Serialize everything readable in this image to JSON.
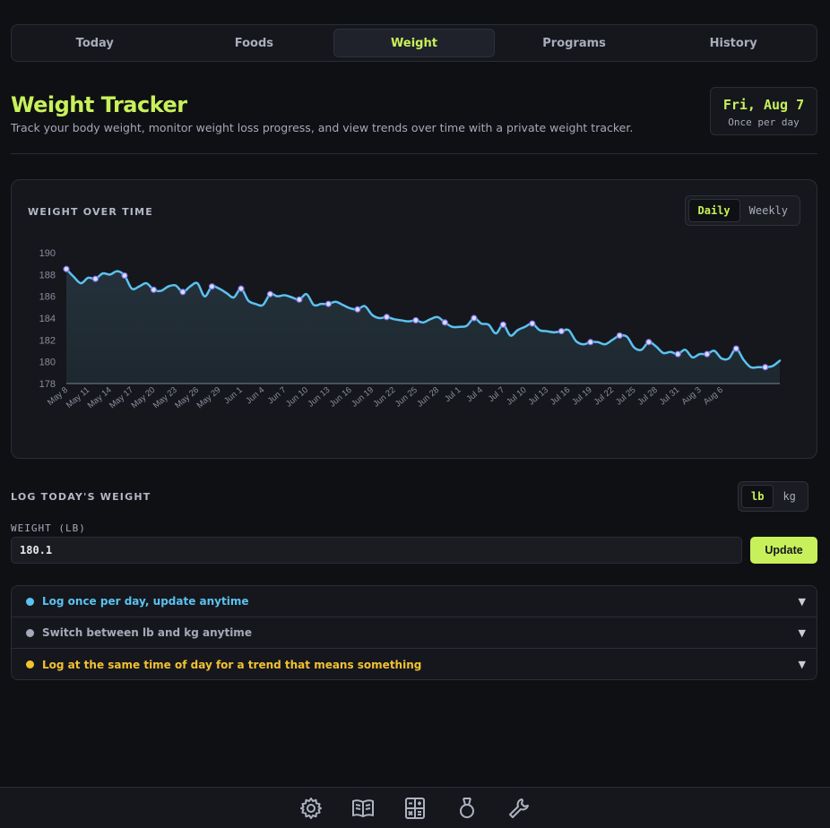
{
  "nav": {
    "tabs": [
      {
        "label": "Today"
      },
      {
        "label": "Foods"
      },
      {
        "label": "Weight"
      },
      {
        "label": "Programs"
      },
      {
        "label": "History"
      }
    ],
    "active": "Weight"
  },
  "header": {
    "title": "Weight Tracker",
    "subtitle": "Track your body weight, monitor weight loss progress, and view trends over time with a private weight tracker.",
    "date": "Fri, Aug 7",
    "frequency": "Once per day"
  },
  "chart_card": {
    "title": "WEIGHT OVER TIME",
    "toggle": [
      "Daily",
      "Weekly"
    ],
    "toggle_selected": "Daily"
  },
  "log": {
    "title": "LOG TODAY'S WEIGHT",
    "units": [
      "lb",
      "kg"
    ],
    "unit_selected": "lb",
    "field_label": "WEIGHT (LB)",
    "value": "180.1",
    "update_label": "Update"
  },
  "tips": [
    {
      "text": "Log once per day, update anytime",
      "color": "#5bc2f0"
    },
    {
      "text": "Switch between lb and kg anytime",
      "color": "#a6aab8"
    },
    {
      "text": "Log at the same time of day for a trend that means something",
      "color": "#f2c230"
    }
  ],
  "colors": {
    "accent": "#c8f05a",
    "line": "#5bc2f0",
    "background": "#0f1014",
    "card": "#15171d"
  },
  "bottom_bar": {
    "icons": [
      "gear-icon",
      "book-icon",
      "calculator-icon",
      "medal-icon",
      "wrench-icon"
    ]
  },
  "chart_data": {
    "type": "area",
    "xlabel": "",
    "ylabel": "",
    "ylim": [
      178,
      190
    ],
    "yticks": [
      178,
      180,
      182,
      184,
      186,
      188,
      190
    ],
    "xtick_labels": [
      "May 8",
      "May 11",
      "May 14",
      "May 17",
      "May 20",
      "May 23",
      "May 26",
      "May 29",
      "Jun 1",
      "Jun 4",
      "Jun 7",
      "Jun 10",
      "Jun 13",
      "Jun 16",
      "Jun 19",
      "Jun 22",
      "Jun 25",
      "Jun 28",
      "Jul 1",
      "Jul 4",
      "Jul 7",
      "Jul 10",
      "Jul 13",
      "Jul 16",
      "Jul 19",
      "Jul 22",
      "Jul 25",
      "Jul 28",
      "Jul 31",
      "Aug 3",
      "Aug 6"
    ],
    "start_date": "May 8",
    "values": [
      188.5,
      187.8,
      187.2,
      187.7,
      187.6,
      188.1,
      188.0,
      188.3,
      187.9,
      186.7,
      186.9,
      187.2,
      186.6,
      186.5,
      186.9,
      187.0,
      186.4,
      186.9,
      187.2,
      186.0,
      186.9,
      186.7,
      186.3,
      185.9,
      186.7,
      185.6,
      185.3,
      185.2,
      186.2,
      186.0,
      186.1,
      185.9,
      185.7,
      186.2,
      185.2,
      185.3,
      185.3,
      185.5,
      185.2,
      184.9,
      184.8,
      185.1,
      184.3,
      184.0,
      184.1,
      183.9,
      183.8,
      183.7,
      183.8,
      183.6,
      183.9,
      184.1,
      183.6,
      183.2,
      183.2,
      183.3,
      184.0,
      183.5,
      183.4,
      182.6,
      183.4,
      182.4,
      182.9,
      183.2,
      183.5,
      182.9,
      182.8,
      182.7,
      182.8,
      182.9,
      181.9,
      181.6,
      181.8,
      181.8,
      181.6,
      182.0,
      182.4,
      182.3,
      181.3,
      181.1,
      181.8,
      181.4,
      180.8,
      180.9,
      180.7,
      181.1,
      180.4,
      180.7,
      180.7,
      181.0,
      180.3,
      180.3,
      181.2,
      180.2,
      179.5,
      179.5,
      179.5,
      179.6,
      180.1
    ],
    "marked_points": [
      0,
      4,
      8,
      12,
      16,
      20,
      24,
      28,
      32,
      36,
      40,
      44,
      48,
      52,
      56,
      60,
      64,
      68,
      72,
      76,
      80,
      84,
      88,
      92,
      96
    ],
    "grid": false,
    "legend": "none"
  }
}
